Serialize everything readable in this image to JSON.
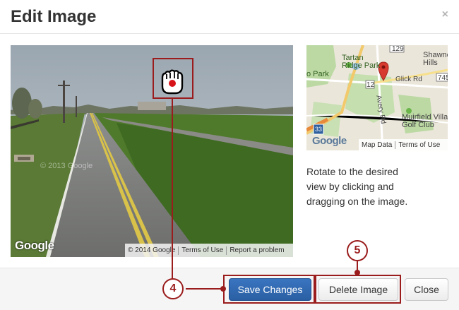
{
  "dialog": {
    "title": "Edit Image",
    "close_glyph": "×"
  },
  "streetview": {
    "logo_text": "Google",
    "watermark": "© 2013 Google",
    "footer": {
      "copyright": "© 2014 Google",
      "terms": "Terms of Use",
      "report": "Report a problem"
    }
  },
  "minimap": {
    "labels": {
      "tartan_ridge_park": "Tartan\nRidge Park",
      "ridge_park": "o Park",
      "shawnee_hills": "Shawne\nHills",
      "glick_rd": "Glick Rd",
      "avery_rd": "Avery Rd",
      "muirfield": "Muirfield Village\nGolf Club",
      "route_129": "129",
      "route_745": "745",
      "route_12": "12",
      "route_33": "33"
    },
    "logo_text": "Google",
    "footer": {
      "map_data": "Map Data",
      "terms": "Terms of Use"
    }
  },
  "instructions": "Rotate to the desired view by clicking and dragging on the image.",
  "footer": {
    "save_label": "Save Changes",
    "delete_label": "Delete Image",
    "close_label": "Close"
  },
  "annotations": {
    "marker_4": "4",
    "marker_5": "5"
  },
  "colors": {
    "primary": "#2d66ae",
    "annotation": "#9a1c1c"
  }
}
